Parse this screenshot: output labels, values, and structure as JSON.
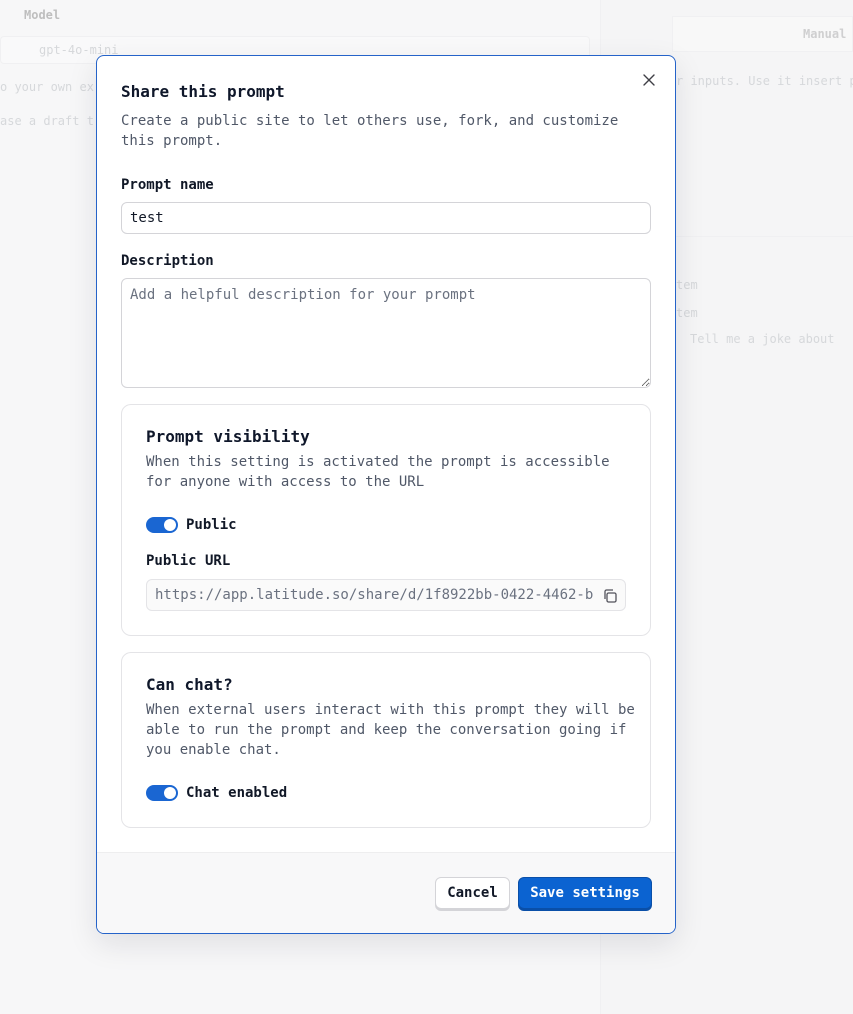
{
  "background": {
    "model_label": "Model",
    "model_value": "gpt-4o-mini",
    "left_line_1": "o your own ex",
    "left_line_2": "ase a draft t",
    "manual_tab": "Manual",
    "right_line_1": "r inputs. Use it insert pa",
    "right_line_2": "tem",
    "right_line_3": "tem",
    "right_line_4": "Tell me a joke about"
  },
  "modal": {
    "title": "Share this prompt",
    "subtitle": "Create a public site to let others use, fork, and customize this prompt.",
    "prompt_name_label": "Prompt name",
    "prompt_name_value": "test",
    "description_label": "Description",
    "description_placeholder": "Add a helpful description for your prompt",
    "visibility": {
      "title": "Prompt visibility",
      "description": "When this setting is activated the prompt is accessible for anyone with access to the URL",
      "toggle_label": "Public",
      "toggle_on": true,
      "url_label": "Public URL",
      "url_value": "https://app.latitude.so/share/d/1f8922bb-0422-4462-b"
    },
    "chat": {
      "title": "Can chat?",
      "description": "When external users interact with this prompt they will be able to run the prompt and keep the conversation going if you enable chat.",
      "toggle_label": "Chat enabled",
      "toggle_on": true
    },
    "cancel_label": "Cancel",
    "save_label": "Save settings"
  },
  "colors": {
    "accent": "#0b63d1",
    "border_focus": "#2563c9"
  }
}
